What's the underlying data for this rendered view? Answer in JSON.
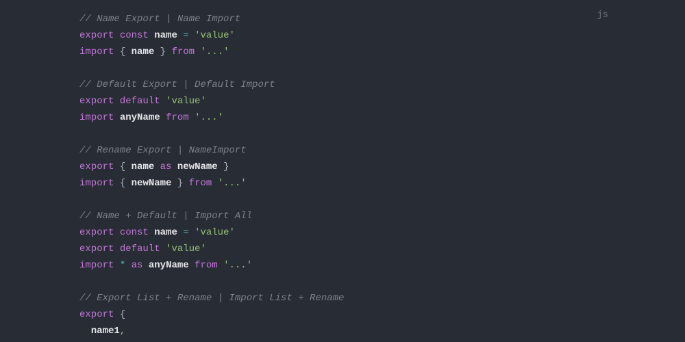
{
  "language_label": "js",
  "code": {
    "lines": [
      [
        {
          "t": "comment",
          "v": "// Name Export | Name Import"
        }
      ],
      [
        {
          "t": "keyword",
          "v": "export"
        },
        {
          "t": "punct",
          "v": " "
        },
        {
          "t": "keyword",
          "v": "const"
        },
        {
          "t": "punct",
          "v": " "
        },
        {
          "t": "ident",
          "v": "name"
        },
        {
          "t": "punct",
          "v": " "
        },
        {
          "t": "op",
          "v": "="
        },
        {
          "t": "punct",
          "v": " "
        },
        {
          "t": "string",
          "v": "'value'"
        }
      ],
      [
        {
          "t": "keyword",
          "v": "import"
        },
        {
          "t": "punct",
          "v": " { "
        },
        {
          "t": "ident",
          "v": "name"
        },
        {
          "t": "punct",
          "v": " } "
        },
        {
          "t": "keyword",
          "v": "from"
        },
        {
          "t": "punct",
          "v": " "
        },
        {
          "t": "string",
          "v": "'...'"
        }
      ],
      [],
      [
        {
          "t": "comment",
          "v": "// Default Export | Default Import"
        }
      ],
      [
        {
          "t": "keyword",
          "v": "export"
        },
        {
          "t": "punct",
          "v": " "
        },
        {
          "t": "keyword",
          "v": "default"
        },
        {
          "t": "punct",
          "v": " "
        },
        {
          "t": "string",
          "v": "'value'"
        }
      ],
      [
        {
          "t": "keyword",
          "v": "import"
        },
        {
          "t": "punct",
          "v": " "
        },
        {
          "t": "ident",
          "v": "anyName"
        },
        {
          "t": "punct",
          "v": " "
        },
        {
          "t": "keyword",
          "v": "from"
        },
        {
          "t": "punct",
          "v": " "
        },
        {
          "t": "string",
          "v": "'...'"
        }
      ],
      [],
      [
        {
          "t": "comment",
          "v": "// Rename Export | NameImport"
        }
      ],
      [
        {
          "t": "keyword",
          "v": "export"
        },
        {
          "t": "punct",
          "v": " { "
        },
        {
          "t": "ident",
          "v": "name"
        },
        {
          "t": "punct",
          "v": " "
        },
        {
          "t": "keyword",
          "v": "as"
        },
        {
          "t": "punct",
          "v": " "
        },
        {
          "t": "ident",
          "v": "newName"
        },
        {
          "t": "punct",
          "v": " }"
        }
      ],
      [
        {
          "t": "keyword",
          "v": "import"
        },
        {
          "t": "punct",
          "v": " { "
        },
        {
          "t": "ident",
          "v": "newName"
        },
        {
          "t": "punct",
          "v": " } "
        },
        {
          "t": "keyword",
          "v": "from"
        },
        {
          "t": "punct",
          "v": " "
        },
        {
          "t": "string",
          "v": "'...'"
        }
      ],
      [],
      [
        {
          "t": "comment",
          "v": "// Name + Default | Import All"
        }
      ],
      [
        {
          "t": "keyword",
          "v": "export"
        },
        {
          "t": "punct",
          "v": " "
        },
        {
          "t": "keyword",
          "v": "const"
        },
        {
          "t": "punct",
          "v": " "
        },
        {
          "t": "ident",
          "v": "name"
        },
        {
          "t": "punct",
          "v": " "
        },
        {
          "t": "op",
          "v": "="
        },
        {
          "t": "punct",
          "v": " "
        },
        {
          "t": "string",
          "v": "'value'"
        }
      ],
      [
        {
          "t": "keyword",
          "v": "export"
        },
        {
          "t": "punct",
          "v": " "
        },
        {
          "t": "keyword",
          "v": "default"
        },
        {
          "t": "punct",
          "v": " "
        },
        {
          "t": "string",
          "v": "'value'"
        }
      ],
      [
        {
          "t": "keyword",
          "v": "import"
        },
        {
          "t": "punct",
          "v": " "
        },
        {
          "t": "op",
          "v": "*"
        },
        {
          "t": "punct",
          "v": " "
        },
        {
          "t": "keyword",
          "v": "as"
        },
        {
          "t": "punct",
          "v": " "
        },
        {
          "t": "ident",
          "v": "anyName"
        },
        {
          "t": "punct",
          "v": " "
        },
        {
          "t": "keyword",
          "v": "from"
        },
        {
          "t": "punct",
          "v": " "
        },
        {
          "t": "string",
          "v": "'...'"
        }
      ],
      [],
      [
        {
          "t": "comment",
          "v": "// Export List + Rename | Import List + Rename"
        }
      ],
      [
        {
          "t": "keyword",
          "v": "export"
        },
        {
          "t": "punct",
          "v": " {"
        }
      ],
      [
        {
          "t": "punct",
          "v": "  "
        },
        {
          "t": "ident",
          "v": "name1"
        },
        {
          "t": "punct",
          "v": ","
        }
      ]
    ]
  }
}
